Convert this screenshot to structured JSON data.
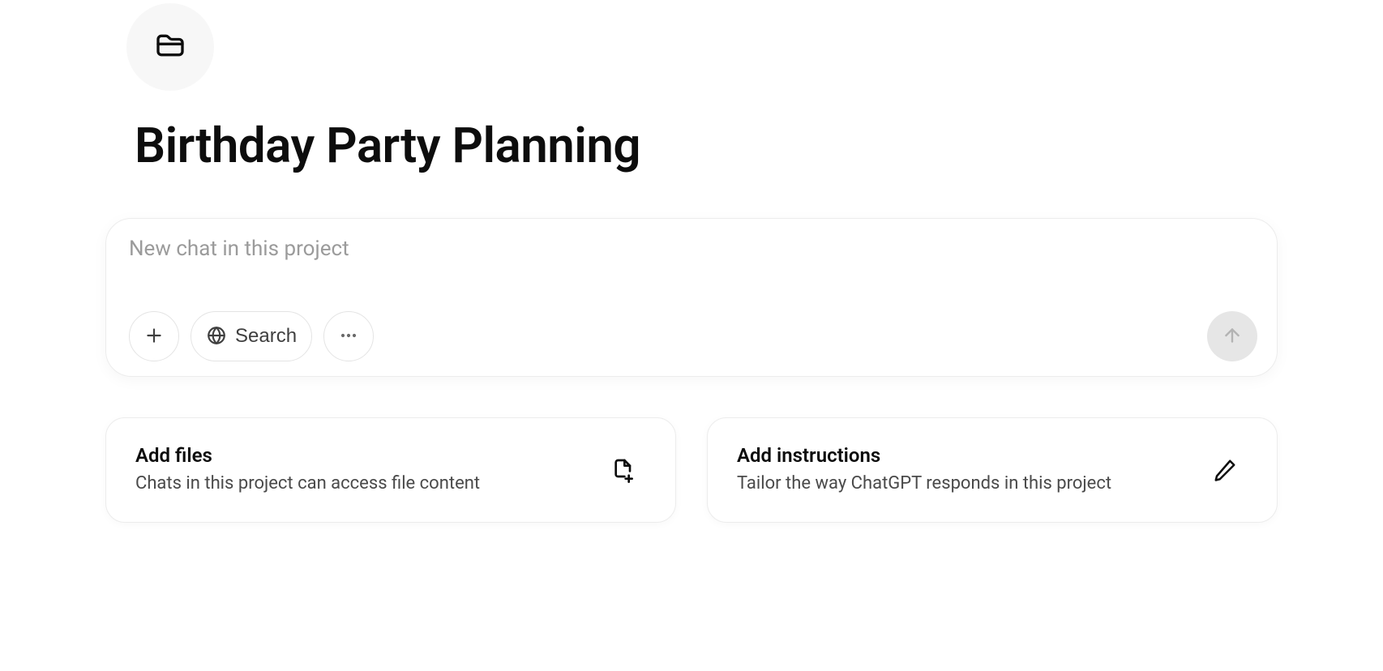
{
  "project": {
    "title": "Birthday Party Planning"
  },
  "chat": {
    "placeholder": "New chat in this project",
    "search_label": "Search"
  },
  "cards": {
    "files": {
      "title": "Add files",
      "desc": "Chats in this project can access file content"
    },
    "instructions": {
      "title": "Add instructions",
      "desc": "Tailor the way ChatGPT responds in this project"
    }
  }
}
